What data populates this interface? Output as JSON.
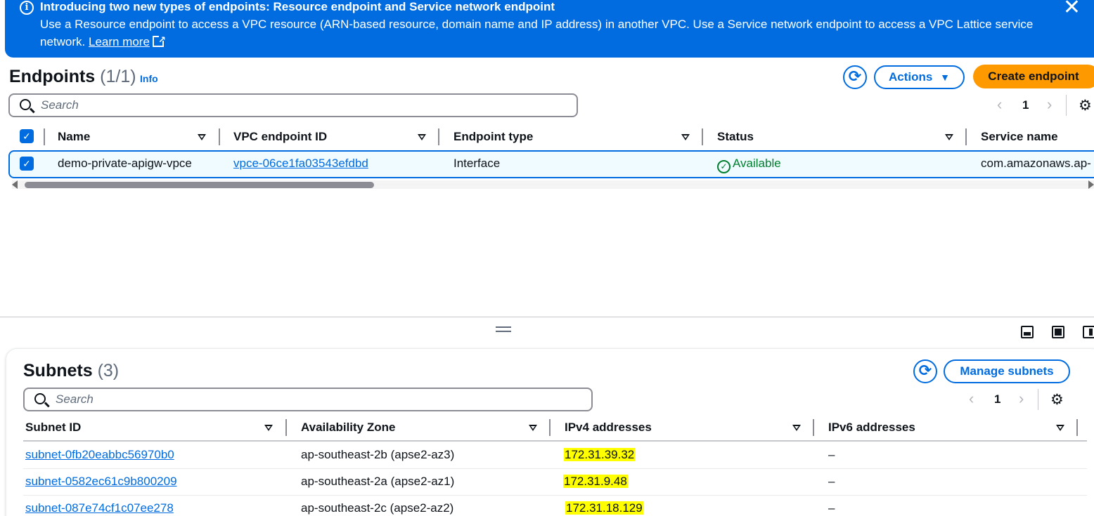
{
  "banner": {
    "title": "Introducing two new types of endpoints: Resource endpoint and Service network endpoint",
    "body": "Use a Resource endpoint to access a VPC resource (ARN-based resource, domain name and IP address) in another VPC. Use a Service network endpoint to access a VPC Lattice service network.",
    "learn_more": "Learn more",
    "info_icon": "info-icon",
    "close": "✕",
    "bg_color": "#006ce0"
  },
  "endpoints": {
    "title": "Endpoints",
    "count": "(1/1)",
    "info": "Info",
    "actions_label": "Actions",
    "create_label": "Create endpoint",
    "search_placeholder": "Search",
    "page": "1",
    "columns": [
      "Name",
      "VPC endpoint ID",
      "Endpoint type",
      "Status",
      "Service name"
    ],
    "rows": [
      {
        "name": "demo-private-apigw-vpce",
        "vpc_endpoint_id": "vpce-06ce1fa03543efdbd",
        "endpoint_type": "Interface",
        "status": "Available",
        "service_name": "com.amazonaws.ap-"
      }
    ]
  },
  "subnets": {
    "title": "Subnets",
    "count": "(3)",
    "manage_label": "Manage subnets",
    "search_placeholder": "Search",
    "page": "1",
    "columns": [
      "Subnet ID",
      "Availability Zone",
      "IPv4 addresses",
      "IPv6 addresses"
    ],
    "rows": [
      {
        "subnet_id": "subnet-0fb20eabbc56970b0",
        "az": "ap-southeast-2b (apse2-az3)",
        "ipv4": "172.31.39.32",
        "ipv6": "–"
      },
      {
        "subnet_id": "subnet-0582ec61c9b800209",
        "az": "ap-southeast-2a (apse2-az1)",
        "ipv4": "172.31.9.48",
        "ipv6": "–"
      },
      {
        "subnet_id": "subnet-087e74cf1c07ee278",
        "az": "ap-southeast-2c (apse2-az2)",
        "ipv4": "172.31.18.129",
        "ipv6": "–"
      }
    ]
  },
  "colors": {
    "primary": "#006ce0",
    "create_button": "#ff9900",
    "success": "#00802f",
    "highlight": "#ffff00"
  }
}
